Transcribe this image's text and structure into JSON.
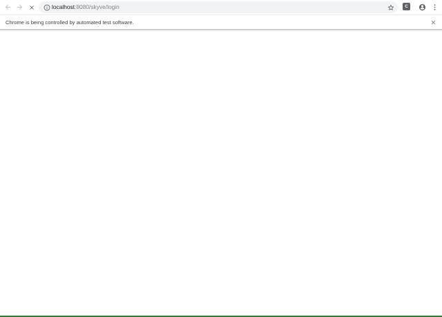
{
  "toolbar": {
    "back_icon": "arrow-left-icon",
    "forward_icon": "arrow-right-icon",
    "stop_icon": "close-icon",
    "info_icon": "info-circle-icon",
    "bookmark_icon": "star-outline-icon",
    "extension_label": "C",
    "profile_icon": "account-circle-icon",
    "menu_icon": "more-vertical-icon"
  },
  "address_bar": {
    "host": "localhost",
    "path": ":8080/skyve/login"
  },
  "infobar": {
    "message": "Chrome is being controlled by automated test software.",
    "close_icon": "close-icon"
  },
  "colors": {
    "icon": "#5f6368",
    "icon_disabled": "#bdc1c6",
    "omnibox_bg": "#f1f3f4",
    "bottom_line": "#2d7d32"
  }
}
